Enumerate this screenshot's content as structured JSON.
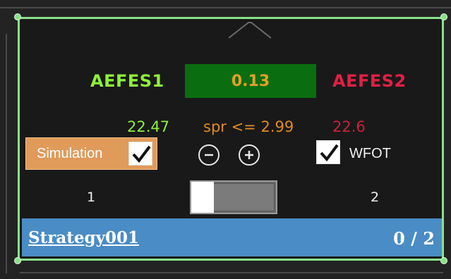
{
  "card": {
    "symbol_left": "AEFES1",
    "symbol_right": "AEFES2",
    "ratio_value": "0.13",
    "price_left": "22.47",
    "spread_condition": "spr <= 2.99",
    "price_right": "22.6",
    "simulation": {
      "label": "Simulation",
      "checked": true
    },
    "wfot": {
      "label": "WFOT",
      "checked": true
    },
    "decrease_icon": "minus-circle-icon",
    "increase_icon": "plus-circle-icon",
    "leg_left_label": "1",
    "leg_right_label": "2",
    "toggle_level": 0.22
  },
  "footer": {
    "strategy_name": "Strategy001",
    "count": "0 / 2"
  },
  "colors": {
    "card_border": "#8be08b",
    "symbol_left": "#8ef03b",
    "symbol_right": "#e02045",
    "ratio_bg": "#0a6e10",
    "ratio_text": "#e0a028",
    "spread_text": "#e28a22",
    "simulation_bg": "#e09a5a",
    "footer_bg": "#4a8cc5"
  }
}
